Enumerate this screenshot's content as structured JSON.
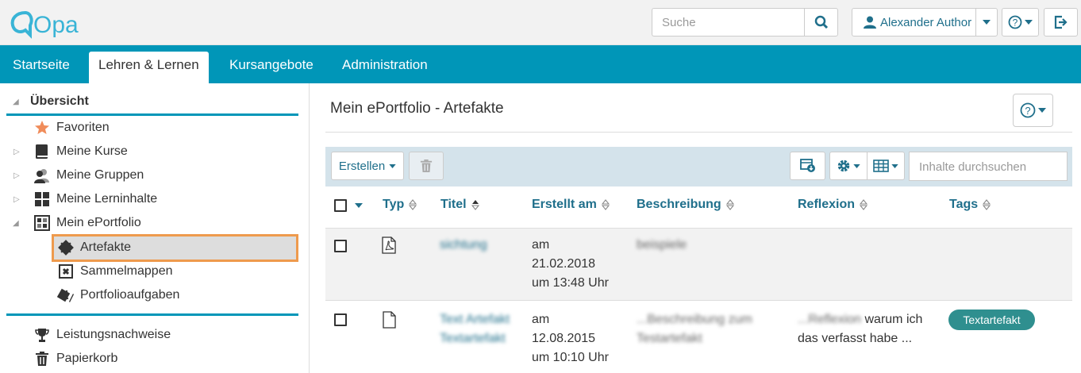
{
  "header": {
    "logo_text": "Opal",
    "search_placeholder": "Suche",
    "user_name": "Alexander Author"
  },
  "nav": {
    "tabs": [
      {
        "label": "Startseite"
      },
      {
        "label": "Lehren & Lernen"
      },
      {
        "label": "Kursangebote"
      },
      {
        "label": "Administration"
      }
    ],
    "active": "Lehren & Lernen"
  },
  "sidebar": {
    "heading": "Übersicht",
    "items": [
      {
        "label": "Favoriten"
      },
      {
        "label": "Meine Kurse"
      },
      {
        "label": "Meine Gruppen"
      },
      {
        "label": "Meine Lerninhalte"
      },
      {
        "label": "Mein ePortfolio"
      },
      {
        "label": "Artefakte"
      },
      {
        "label": "Sammelmappen"
      },
      {
        "label": "Portfolioaufgaben"
      },
      {
        "label": "Leistungsnachweise"
      },
      {
        "label": "Papierkorb"
      }
    ],
    "selected": "Artefakte"
  },
  "main": {
    "title": "Mein ePortfolio - Artefakte",
    "toolbar": {
      "create_label": "Erstellen",
      "search_placeholder": "Inhalte durchsuchen"
    },
    "columns": [
      "Typ",
      "Titel",
      "Erstellt am",
      "Beschreibung",
      "Reflexion",
      "Tags"
    ],
    "rows": [
      {
        "type_icon": "pdf-file-icon",
        "title": "sichtung",
        "created": [
          "am",
          "21.02.2018",
          "um 13:48 Uhr"
        ],
        "description": "beispiele",
        "reflection": "",
        "tag": ""
      },
      {
        "type_icon": "text-file-icon",
        "title": [
          "Text Artefakt",
          "Textartefakt"
        ],
        "created": [
          "am",
          "12.08.2015",
          "um 10:10 Uhr"
        ],
        "description": [
          "...Beschreibung zum",
          "Testartefakt"
        ],
        "reflection_hidden": "...Reflexion",
        "reflection_visible": " warum ich",
        "reflection_line2": "das verfasst habe ...",
        "tag": "Textartefakt"
      }
    ]
  },
  "colors": {
    "accent": "#0096b8",
    "link": "#1f6f8b",
    "highlight_border": "#ee9a4d",
    "tag_bg": "#2f8f8f"
  }
}
